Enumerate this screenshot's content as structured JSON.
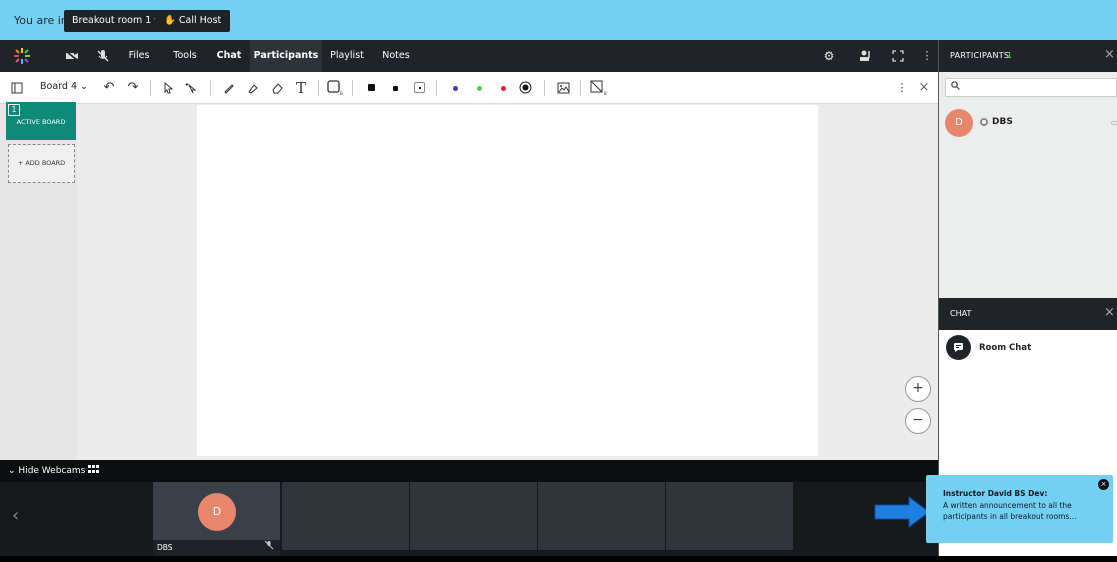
{
  "location_bar": {
    "you_are_in": "You are in:",
    "room": "Breakout room 1",
    "room_chevron": "▾",
    "call_host": "Call Host",
    "call_host_icon": "✋"
  },
  "nav": {
    "files": "Files",
    "tools": "Tools",
    "chat": "Chat",
    "participants": "Participants",
    "playlist": "Playlist",
    "notes": "Notes",
    "icons": [
      "logo-icon",
      "camera-off-icon",
      "mic-off-icon",
      "settings-icon",
      "raise-hand-icon",
      "fullscreen-icon",
      "more-icon"
    ]
  },
  "toolbar": {
    "board_name": "Board 4",
    "board_chevron": "⌄",
    "text_tool": "T"
  },
  "boards": {
    "active_number": "1",
    "active_label": "ACTIVE BOARD",
    "add_label": "+ ADD BOARD"
  },
  "zoom": {
    "in": "+",
    "out": "−"
  },
  "webcams": {
    "hide_label": "Hide Webcams",
    "tile_name": "DBS",
    "tile_initial": "D"
  },
  "participants": {
    "title": "PARTICIPANTS",
    "count": "1",
    "close": "×",
    "search_icon": "⚲",
    "user_initial": "D",
    "user_name": "DBS"
  },
  "chat": {
    "title": "CHAT",
    "close": "×",
    "room_chat_label": "Room Chat"
  },
  "announcement": {
    "title": "Instructor David BS Dev:",
    "text": "A written announcement to all the participants in all breakout rooms...",
    "close": "×"
  },
  "colors": {
    "accent_blue": "#74d0f3",
    "teal": "#0d8a7a",
    "avatar_orange": "#e8866d",
    "dark": "#202428",
    "count_green": "#6dd36d",
    "dot_blue": "#3a3ab8",
    "dot_green": "#4cd14c",
    "dot_red": "#e0202a",
    "arrow_blue": "#1e7fe0"
  }
}
